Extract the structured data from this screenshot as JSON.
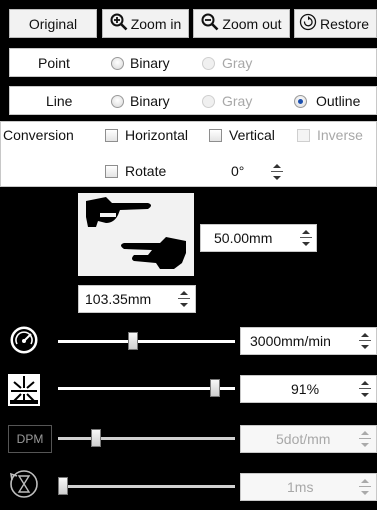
{
  "toolbar": {
    "original_label": "Original",
    "zoom_in_label": "Zoom in",
    "zoom_out_label": "Zoom out",
    "restore_label": "Restore"
  },
  "point_row": {
    "label": "Point",
    "options": [
      "Binary",
      "Gray"
    ],
    "selected": "none"
  },
  "line_row": {
    "label": "Line",
    "options": [
      "Binary",
      "Gray",
      "Outline"
    ],
    "selected": "Outline"
  },
  "conversion": {
    "label": "Conversion",
    "horizontal_label": "Horizontal",
    "vertical_label": "Vertical",
    "inverse_label": "Inverse",
    "rotate_label": "Rotate",
    "rotate_value": "0°"
  },
  "image_panel": {
    "height_value": "50.00mm",
    "width_value": "103.35mm"
  },
  "speed": {
    "icon": "speedometer-icon",
    "value": "3000mm/min",
    "level": 0.42
  },
  "power": {
    "icon": "laser-burst-icon",
    "value": "91%",
    "level": 0.91
  },
  "dpm": {
    "label": "DPM",
    "value": "5dot/mm",
    "level": 0.2
  },
  "delay": {
    "icon": "hourglass-timer-icon",
    "value": "1ms",
    "level": 0.0
  },
  "colors": {
    "background": "#000000",
    "panel": "#ffffff",
    "accent_radio": "#1b4fae",
    "disabled_text": "#a8a8a8"
  }
}
